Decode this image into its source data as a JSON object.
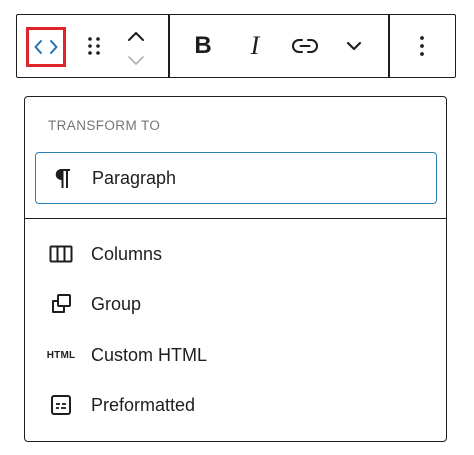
{
  "toolbar": {
    "buttons": [
      {
        "name": "transform-button",
        "icon": "code-icon",
        "highlighted": true
      },
      {
        "name": "drag-handle",
        "icon": "drag-handle-icon"
      },
      {
        "name": "move-up-button",
        "icon": "chevron-up-icon"
      },
      {
        "name": "move-down-button",
        "icon": "chevron-down-icon",
        "disabled": true
      },
      {
        "name": "bold-button",
        "label": "B"
      },
      {
        "name": "italic-button",
        "label": "I"
      },
      {
        "name": "link-button",
        "icon": "link-icon"
      },
      {
        "name": "more-formatting-button",
        "icon": "chevron-down-icon"
      },
      {
        "name": "options-button",
        "icon": "more-vertical-icon"
      }
    ],
    "bold_label": "B",
    "italic_label": "I"
  },
  "panel": {
    "heading": "TRANSFORM TO",
    "selected_item": {
      "label": "Paragraph",
      "icon": "pilcrow-icon"
    },
    "items": [
      {
        "label": "Columns",
        "icon": "columns-icon"
      },
      {
        "label": "Group",
        "icon": "group-icon"
      },
      {
        "label": "Custom HTML",
        "icon": "html-icon",
        "icon_text": "HTML"
      },
      {
        "label": "Preformatted",
        "icon": "preformatted-icon"
      }
    ]
  },
  "colors": {
    "text": "#1e1e1e",
    "muted": "#757575",
    "focus_border": "#2d7fb3",
    "highlight_red": "#e0242b",
    "accent_blue": "#2271b1",
    "disabled": "#b0b0b0"
  }
}
